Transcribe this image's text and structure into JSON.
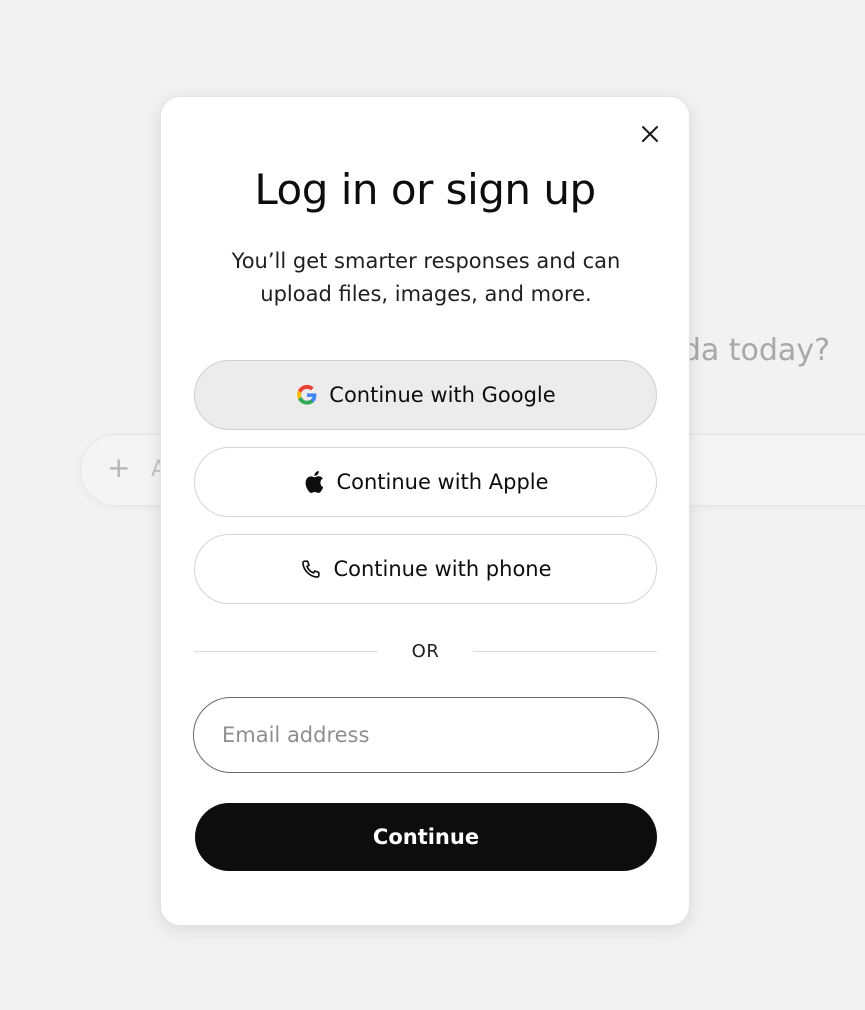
{
  "background": {
    "heading_partial": "da today?",
    "composer_plus": "+",
    "composer_placeholder_partial": "A"
  },
  "modal": {
    "title": "Log in or sign up",
    "subtitle": "You’ll get smarter responses and can upload files, images, and more.",
    "close_icon": "close-icon",
    "oauth_buttons": [
      {
        "label": "Continue with Google",
        "icon": "google-icon",
        "state": "hover"
      },
      {
        "label": "Continue with Apple",
        "icon": "apple-icon"
      },
      {
        "label": "Continue with phone",
        "icon": "phone-icon"
      }
    ],
    "divider_text": "OR",
    "email": {
      "placeholder": "Email address",
      "value": ""
    },
    "continue_label": "Continue"
  },
  "colors": {
    "primary_button": "#0d0d0d",
    "hover_button": "#ececec",
    "backdrop": "#f1f1f1"
  }
}
